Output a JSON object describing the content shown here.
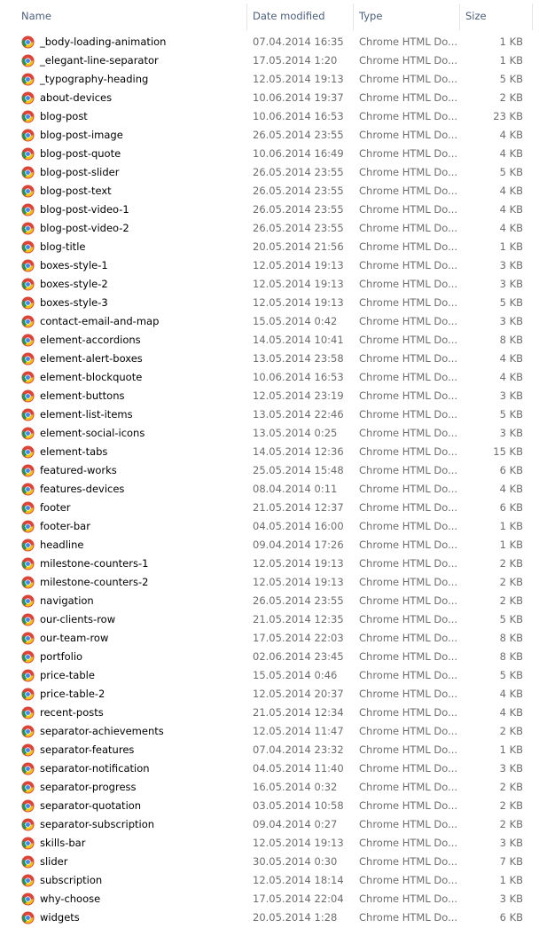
{
  "columns": {
    "name": "Name",
    "date_modified": "Date modified",
    "type": "Type",
    "size": "Size"
  },
  "icon": "chrome-html-file-icon",
  "colors": {
    "header_text": "#4c607a",
    "secondary_text": "#6d6d6d",
    "chrome_red": "#db4437",
    "chrome_yellow": "#f4c20d",
    "chrome_green": "#0f9d58",
    "chrome_blue": "#4285f4"
  },
  "files": [
    {
      "name": "_body-loading-animation",
      "date": "07.04.2014 16:35",
      "type": "Chrome HTML Do...",
      "size": "1 KB"
    },
    {
      "name": "_elegant-line-separator",
      "date": "17.05.2014 1:20",
      "type": "Chrome HTML Do...",
      "size": "1 KB"
    },
    {
      "name": "_typography-heading",
      "date": "12.05.2014 19:13",
      "type": "Chrome HTML Do...",
      "size": "5 KB"
    },
    {
      "name": "about-devices",
      "date": "10.06.2014 19:37",
      "type": "Chrome HTML Do...",
      "size": "2 KB"
    },
    {
      "name": "blog-post",
      "date": "10.06.2014 16:53",
      "type": "Chrome HTML Do...",
      "size": "23 KB"
    },
    {
      "name": "blog-post-image",
      "date": "26.05.2014 23:55",
      "type": "Chrome HTML Do...",
      "size": "4 KB"
    },
    {
      "name": "blog-post-quote",
      "date": "10.06.2014 16:49",
      "type": "Chrome HTML Do...",
      "size": "4 KB"
    },
    {
      "name": "blog-post-slider",
      "date": "26.05.2014 23:55",
      "type": "Chrome HTML Do...",
      "size": "5 KB"
    },
    {
      "name": "blog-post-text",
      "date": "26.05.2014 23:55",
      "type": "Chrome HTML Do...",
      "size": "4 KB"
    },
    {
      "name": "blog-post-video-1",
      "date": "26.05.2014 23:55",
      "type": "Chrome HTML Do...",
      "size": "4 KB"
    },
    {
      "name": "blog-post-video-2",
      "date": "26.05.2014 23:55",
      "type": "Chrome HTML Do...",
      "size": "4 KB"
    },
    {
      "name": "blog-title",
      "date": "20.05.2014 21:56",
      "type": "Chrome HTML Do...",
      "size": "1 KB"
    },
    {
      "name": "boxes-style-1",
      "date": "12.05.2014 19:13",
      "type": "Chrome HTML Do...",
      "size": "3 KB"
    },
    {
      "name": "boxes-style-2",
      "date": "12.05.2014 19:13",
      "type": "Chrome HTML Do...",
      "size": "3 KB"
    },
    {
      "name": "boxes-style-3",
      "date": "12.05.2014 19:13",
      "type": "Chrome HTML Do...",
      "size": "5 KB"
    },
    {
      "name": "contact-email-and-map",
      "date": "15.05.2014 0:42",
      "type": "Chrome HTML Do...",
      "size": "3 KB"
    },
    {
      "name": "element-accordions",
      "date": "14.05.2014 10:41",
      "type": "Chrome HTML Do...",
      "size": "8 KB"
    },
    {
      "name": "element-alert-boxes",
      "date": "13.05.2014 23:58",
      "type": "Chrome HTML Do...",
      "size": "4 KB"
    },
    {
      "name": "element-blockquote",
      "date": "10.06.2014 16:53",
      "type": "Chrome HTML Do...",
      "size": "4 KB"
    },
    {
      "name": "element-buttons",
      "date": "12.05.2014 23:19",
      "type": "Chrome HTML Do...",
      "size": "3 KB"
    },
    {
      "name": "element-list-items",
      "date": "13.05.2014 22:46",
      "type": "Chrome HTML Do...",
      "size": "5 KB"
    },
    {
      "name": "element-social-icons",
      "date": "13.05.2014 0:25",
      "type": "Chrome HTML Do...",
      "size": "3 KB"
    },
    {
      "name": "element-tabs",
      "date": "14.05.2014 12:36",
      "type": "Chrome HTML Do...",
      "size": "15 KB"
    },
    {
      "name": "featured-works",
      "date": "25.05.2014 15:48",
      "type": "Chrome HTML Do...",
      "size": "6 KB"
    },
    {
      "name": "features-devices",
      "date": "08.04.2014 0:11",
      "type": "Chrome HTML Do...",
      "size": "4 KB"
    },
    {
      "name": "footer",
      "date": "21.05.2014 12:37",
      "type": "Chrome HTML Do...",
      "size": "6 KB"
    },
    {
      "name": "footer-bar",
      "date": "04.05.2014 16:00",
      "type": "Chrome HTML Do...",
      "size": "1 KB"
    },
    {
      "name": "headline",
      "date": "09.04.2014 17:26",
      "type": "Chrome HTML Do...",
      "size": "1 KB"
    },
    {
      "name": "milestone-counters-1",
      "date": "12.05.2014 19:13",
      "type": "Chrome HTML Do...",
      "size": "2 KB"
    },
    {
      "name": "milestone-counters-2",
      "date": "12.05.2014 19:13",
      "type": "Chrome HTML Do...",
      "size": "2 KB"
    },
    {
      "name": "navigation",
      "date": "26.05.2014 23:55",
      "type": "Chrome HTML Do...",
      "size": "2 KB"
    },
    {
      "name": "our-clients-row",
      "date": "21.05.2014 12:35",
      "type": "Chrome HTML Do...",
      "size": "5 KB"
    },
    {
      "name": "our-team-row",
      "date": "17.05.2014 22:03",
      "type": "Chrome HTML Do...",
      "size": "8 KB"
    },
    {
      "name": "portfolio",
      "date": "02.06.2014 23:45",
      "type": "Chrome HTML Do...",
      "size": "8 KB"
    },
    {
      "name": "price-table",
      "date": "15.05.2014 0:46",
      "type": "Chrome HTML Do...",
      "size": "5 KB"
    },
    {
      "name": "price-table-2",
      "date": "12.05.2014 20:37",
      "type": "Chrome HTML Do...",
      "size": "4 KB"
    },
    {
      "name": "recent-posts",
      "date": "21.05.2014 12:34",
      "type": "Chrome HTML Do...",
      "size": "4 KB"
    },
    {
      "name": "separator-achievements",
      "date": "12.05.2014 11:47",
      "type": "Chrome HTML Do...",
      "size": "2 KB"
    },
    {
      "name": "separator-features",
      "date": "07.04.2014 23:32",
      "type": "Chrome HTML Do...",
      "size": "1 KB"
    },
    {
      "name": "separator-notification",
      "date": "04.05.2014 11:40",
      "type": "Chrome HTML Do...",
      "size": "3 KB"
    },
    {
      "name": "separator-progress",
      "date": "16.05.2014 0:32",
      "type": "Chrome HTML Do...",
      "size": "2 KB"
    },
    {
      "name": "separator-quotation",
      "date": "03.05.2014 10:58",
      "type": "Chrome HTML Do...",
      "size": "2 KB"
    },
    {
      "name": "separator-subscription",
      "date": "09.04.2014 0:27",
      "type": "Chrome HTML Do...",
      "size": "2 KB"
    },
    {
      "name": "skills-bar",
      "date": "12.05.2014 19:13",
      "type": "Chrome HTML Do...",
      "size": "3 KB"
    },
    {
      "name": "slider",
      "date": "30.05.2014 0:30",
      "type": "Chrome HTML Do...",
      "size": "7 KB"
    },
    {
      "name": "subscription",
      "date": "12.05.2014 18:14",
      "type": "Chrome HTML Do...",
      "size": "1 KB"
    },
    {
      "name": "why-choose",
      "date": "17.05.2014 22:04",
      "type": "Chrome HTML Do...",
      "size": "3 KB"
    },
    {
      "name": "widgets",
      "date": "20.05.2014 1:28",
      "type": "Chrome HTML Do...",
      "size": "6 KB"
    }
  ]
}
